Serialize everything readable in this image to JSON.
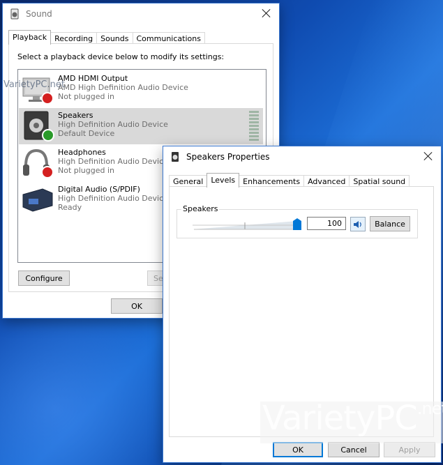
{
  "sound_window": {
    "title": "Sound",
    "tabs": [
      "Playback",
      "Recording",
      "Sounds",
      "Communications"
    ],
    "instruction": "Select a playback device below to modify its settings:",
    "devices": [
      {
        "name": "AMD HDMI Output",
        "driver": "AMD High Definition Audio Device",
        "status": "Not plugged in",
        "icon": "monitor-icon",
        "badge": "unplugged"
      },
      {
        "name": "Speakers",
        "driver": "High Definition Audio Device",
        "status": "Default Device",
        "icon": "speaker-icon",
        "badge": "default"
      },
      {
        "name": "Headphones",
        "driver": "High Definition Audio Devic",
        "status": "Not plugged in",
        "icon": "headphones-icon",
        "badge": "unplugged"
      },
      {
        "name": "Digital Audio (S/PDIF)",
        "driver": "High Definition Audio Devic",
        "status": "Ready",
        "icon": "digital-audio-icon",
        "badge": "none"
      }
    ],
    "configure_label": "Configure",
    "set_default_partial": "Se",
    "ok_label": "OK"
  },
  "speakers_window": {
    "title": "Speakers Properties",
    "tabs": [
      "General",
      "Levels",
      "Enhancements",
      "Advanced",
      "Spatial sound"
    ],
    "active_tab": "Levels",
    "level_group_label": "Speakers",
    "volume_value": "100",
    "volume_level_percent": 100,
    "balance_label": "Balance",
    "ok_label": "OK",
    "cancel_label": "Cancel",
    "apply_label": "Apply"
  },
  "watermark": {
    "text_main": "Variety",
    "text_pc": "PC",
    "text_suffix": ".net",
    "small_text": "VarietyPC.net"
  },
  "colors": {
    "accent": "#0078d7",
    "selection": "#d9d9d9",
    "desktop": "#0f4bb0"
  }
}
